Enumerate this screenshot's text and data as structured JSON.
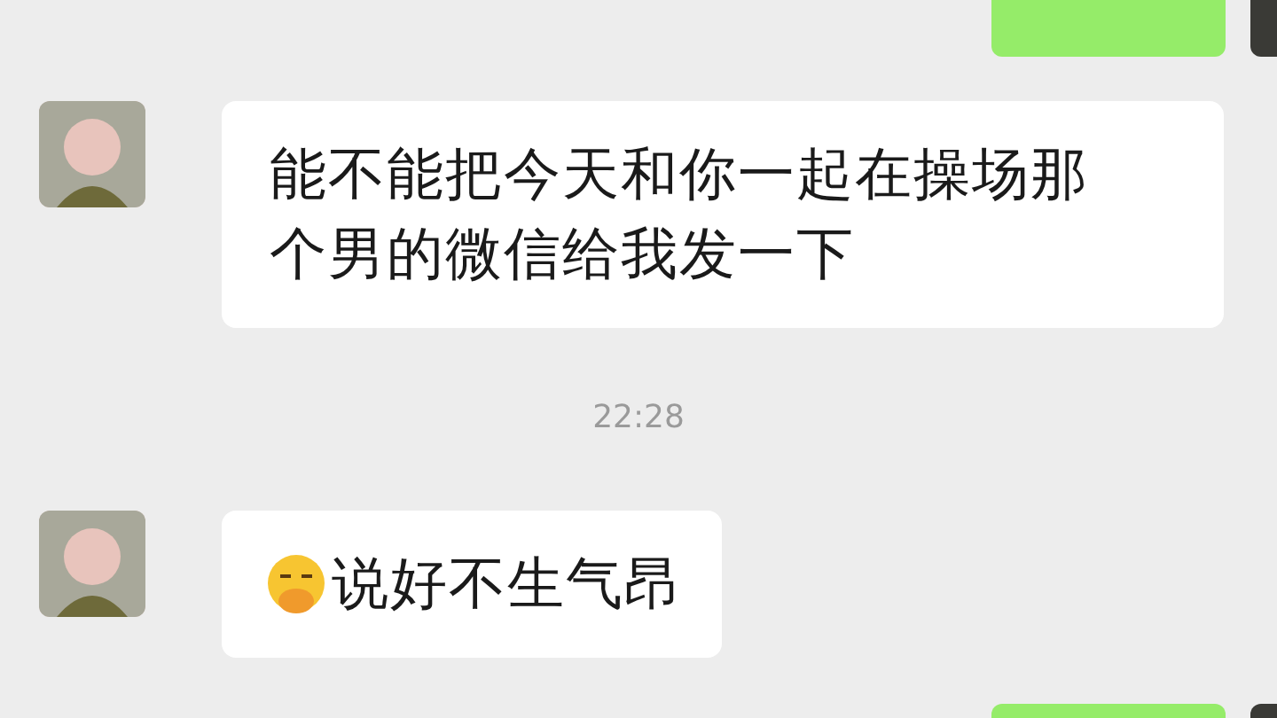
{
  "messages": [
    {
      "kind": "outgoing"
    },
    {
      "kind": "incoming",
      "text": "能不能把今天和你一起在操场那个男的微信给我发一下",
      "emoji": false
    },
    {
      "kind": "time",
      "text": "22:28"
    },
    {
      "kind": "incoming",
      "text": "说好不生气昂",
      "emoji": true
    },
    {
      "kind": "outgoing"
    }
  ]
}
